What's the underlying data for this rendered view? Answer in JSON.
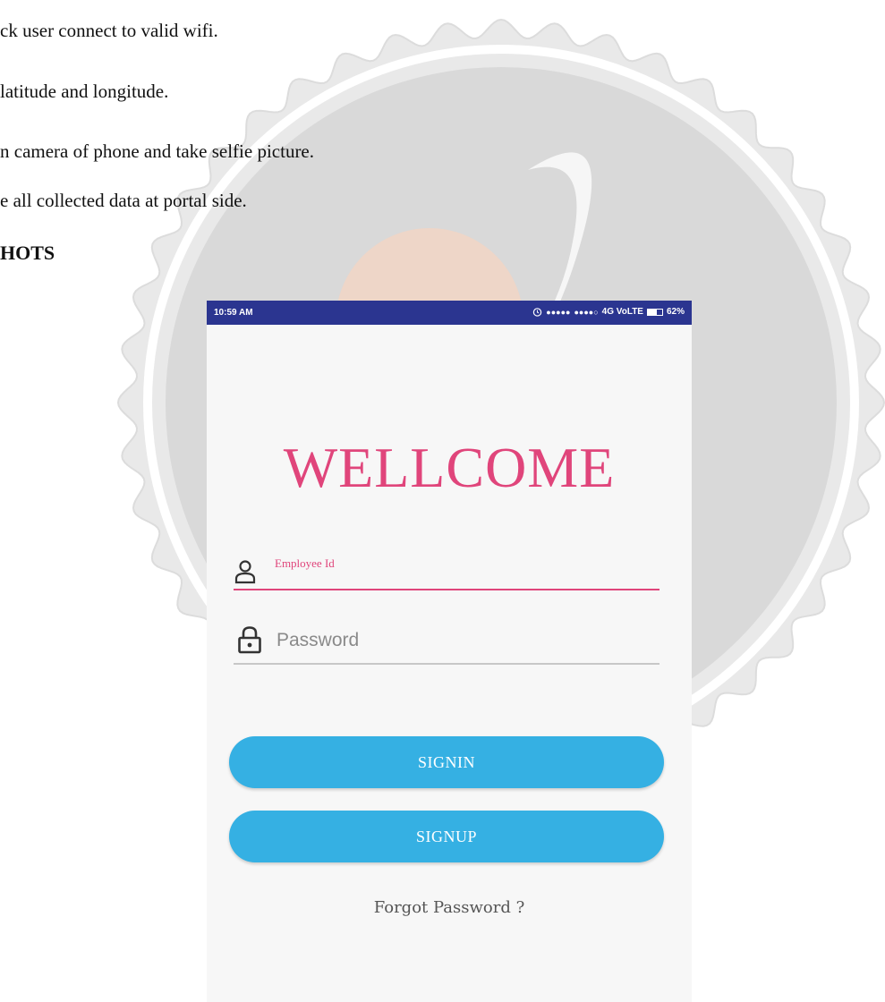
{
  "document": {
    "lines": [
      "ck user connect to valid wifi.",
      "latitude and longitude.",
      "n camera of phone and take selfie picture.",
      "e all collected data at portal side."
    ],
    "heading": "HOTS"
  },
  "phone": {
    "status_bar": {
      "time": "10:59 AM",
      "alarm_icon": "alarm-icon",
      "signal_1": "●●●●●",
      "signal_2": "●●●●○",
      "network": "4G VoLTE",
      "battery": "62%",
      "battery_level": 0.62
    },
    "title": "WELLCOME",
    "employee_field": {
      "label": "Employee Id",
      "value": "",
      "icon": "user-icon"
    },
    "password_field": {
      "placeholder": "Password",
      "icon": "lock-icon"
    },
    "signin_label": "SIGNIN",
    "signup_label": "SIGNUP",
    "forgot_label": "Forgot Password ?"
  },
  "colors": {
    "accent_pink": "#e0457b",
    "button_blue": "#35b0e3",
    "status_bar": "#2b3590"
  }
}
